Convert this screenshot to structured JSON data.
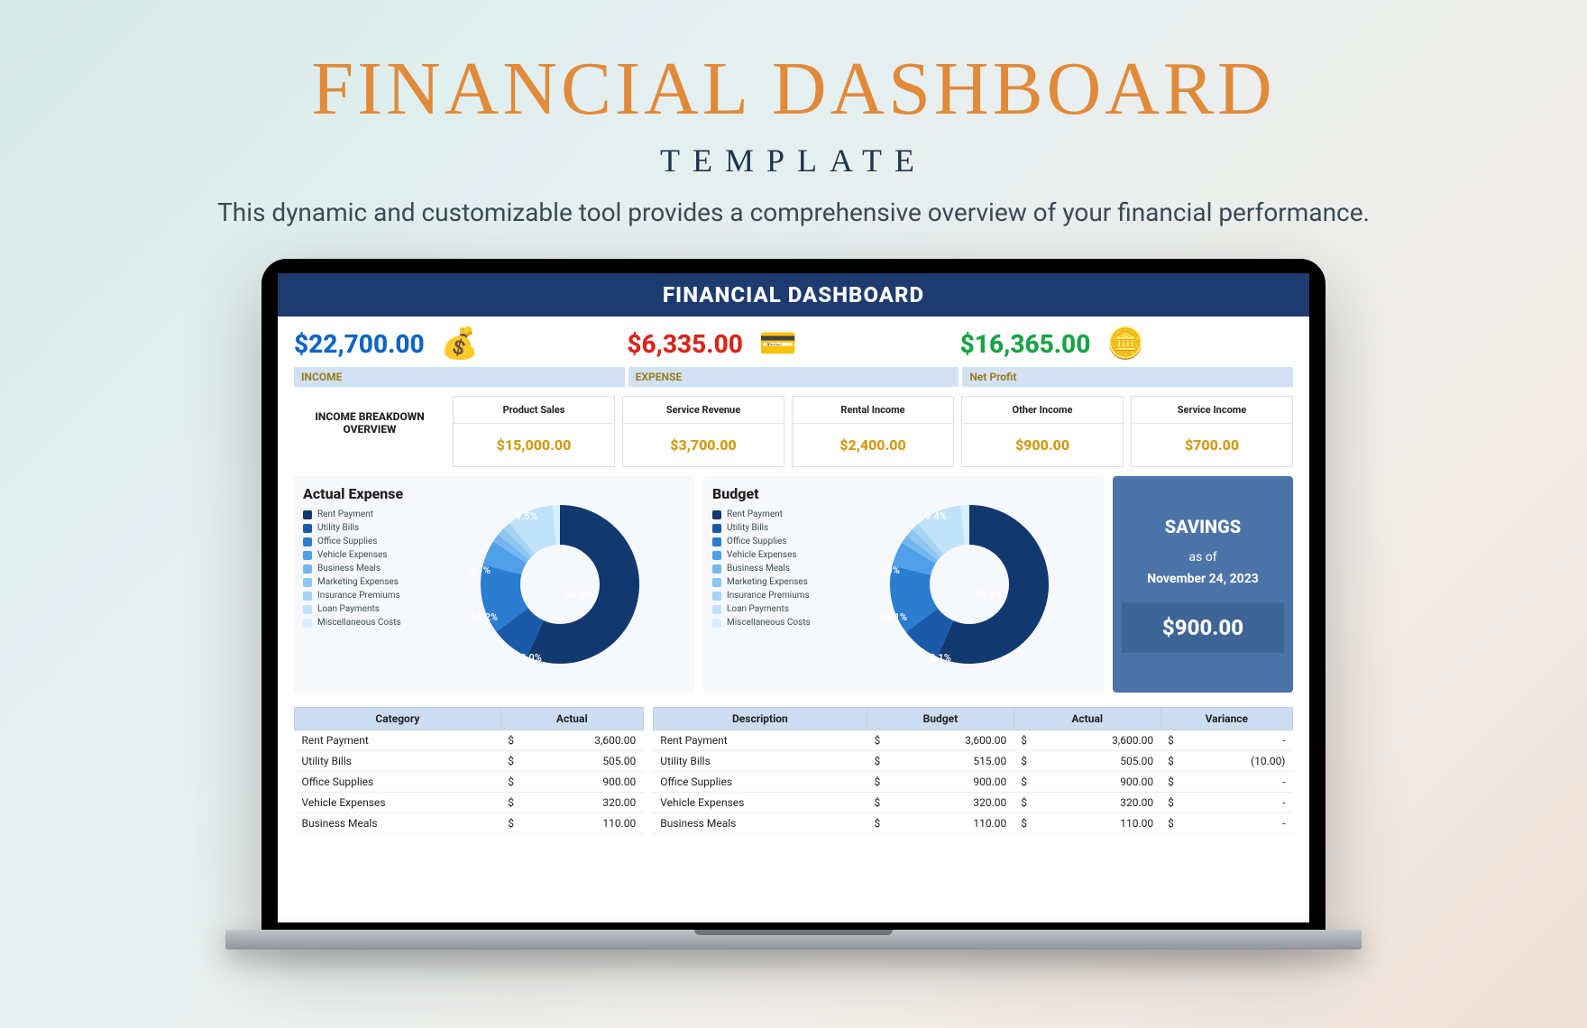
{
  "hero": {
    "title": "FINANCIAL DASHBOARD",
    "subtitle": "TEMPLATE",
    "tagline": "This dynamic and customizable tool provides a comprehensive overview of your financial performance."
  },
  "dash": {
    "title": "FINANCIAL DASHBOARD"
  },
  "kpi": {
    "income": "$22,700.00",
    "expense": "$6,335.00",
    "netprofit": "$16,365.00"
  },
  "labels": {
    "income": "INCOME",
    "expense": "EXPENSE",
    "netprofit": "Net Profit",
    "overview": "INCOME BREAKDOWN OVERVIEW",
    "actual_expense": "Actual Expense",
    "budget": "Budget",
    "savings": "SAVINGS",
    "asof": "as of",
    "date": "November 24, 2023"
  },
  "savings_value": "$900.00",
  "income_cards": [
    {
      "label": "Product Sales",
      "value": "$15,000.00"
    },
    {
      "label": "Service Revenue",
      "value": "$3,700.00"
    },
    {
      "label": "Rental Income",
      "value": "$2,400.00"
    },
    {
      "label": "Other Income",
      "value": "$900.00"
    },
    {
      "label": "Service Income",
      "value": "$700.00"
    }
  ],
  "chart_data": [
    {
      "type": "pie",
      "title": "Actual Expense",
      "categories": [
        "Rent Payment",
        "Utility Bills",
        "Office Supplies",
        "Vehicle Expenses",
        "Business Meals",
        "Marketing Expenses",
        "Insurance Premiums",
        "Loan Payments",
        "Miscellaneous Costs"
      ],
      "values": [
        56.8,
        8.0,
        14.2,
        5.1,
        1.7,
        1.7,
        1.5,
        9.5,
        1.5
      ],
      "labels_shown": [
        "56.8%",
        "8.0%",
        "14.2%",
        "5.1%",
        "9.5%"
      ]
    },
    {
      "type": "pie",
      "title": "Budget",
      "categories": [
        "Rent Payment",
        "Utility Bills",
        "Office Supplies",
        "Vehicle Expenses",
        "Business Meals",
        "Marketing Expenses",
        "Insurance Premiums",
        "Loan Payments",
        "Miscellaneous Costs"
      ],
      "values": [
        56.6,
        8.1,
        14.1,
        5.0,
        1.7,
        1.7,
        1.6,
        9.4,
        1.8
      ],
      "labels_shown": [
        "56.6%",
        "8.1%",
        "14.1%",
        "5.0%",
        "9.4%"
      ]
    }
  ],
  "colors": [
    "#11396f",
    "#1b5aa8",
    "#2a7dd1",
    "#4fa0e8",
    "#74b7ee",
    "#8dc6f1",
    "#a6d4f4",
    "#bfe2f8",
    "#d7eefb"
  ],
  "table1": {
    "headers": [
      "Category",
      "Actual"
    ],
    "rows": [
      [
        "Rent Payment",
        "3,600.00"
      ],
      [
        "Utility Bills",
        "505.00"
      ],
      [
        "Office Supplies",
        "900.00"
      ],
      [
        "Vehicle Expenses",
        "320.00"
      ],
      [
        "Business Meals",
        "110.00"
      ]
    ]
  },
  "table2": {
    "headers": [
      "Description",
      "Budget",
      "Actual",
      "Variance"
    ],
    "rows": [
      [
        "Rent Payment",
        "3,600.00",
        "3,600.00",
        "-"
      ],
      [
        "Utility Bills",
        "515.00",
        "505.00",
        "(10.00)"
      ],
      [
        "Office Supplies",
        "900.00",
        "900.00",
        "-"
      ],
      [
        "Vehicle Expenses",
        "320.00",
        "320.00",
        "-"
      ],
      [
        "Business Meals",
        "110.00",
        "110.00",
        "-"
      ]
    ]
  }
}
